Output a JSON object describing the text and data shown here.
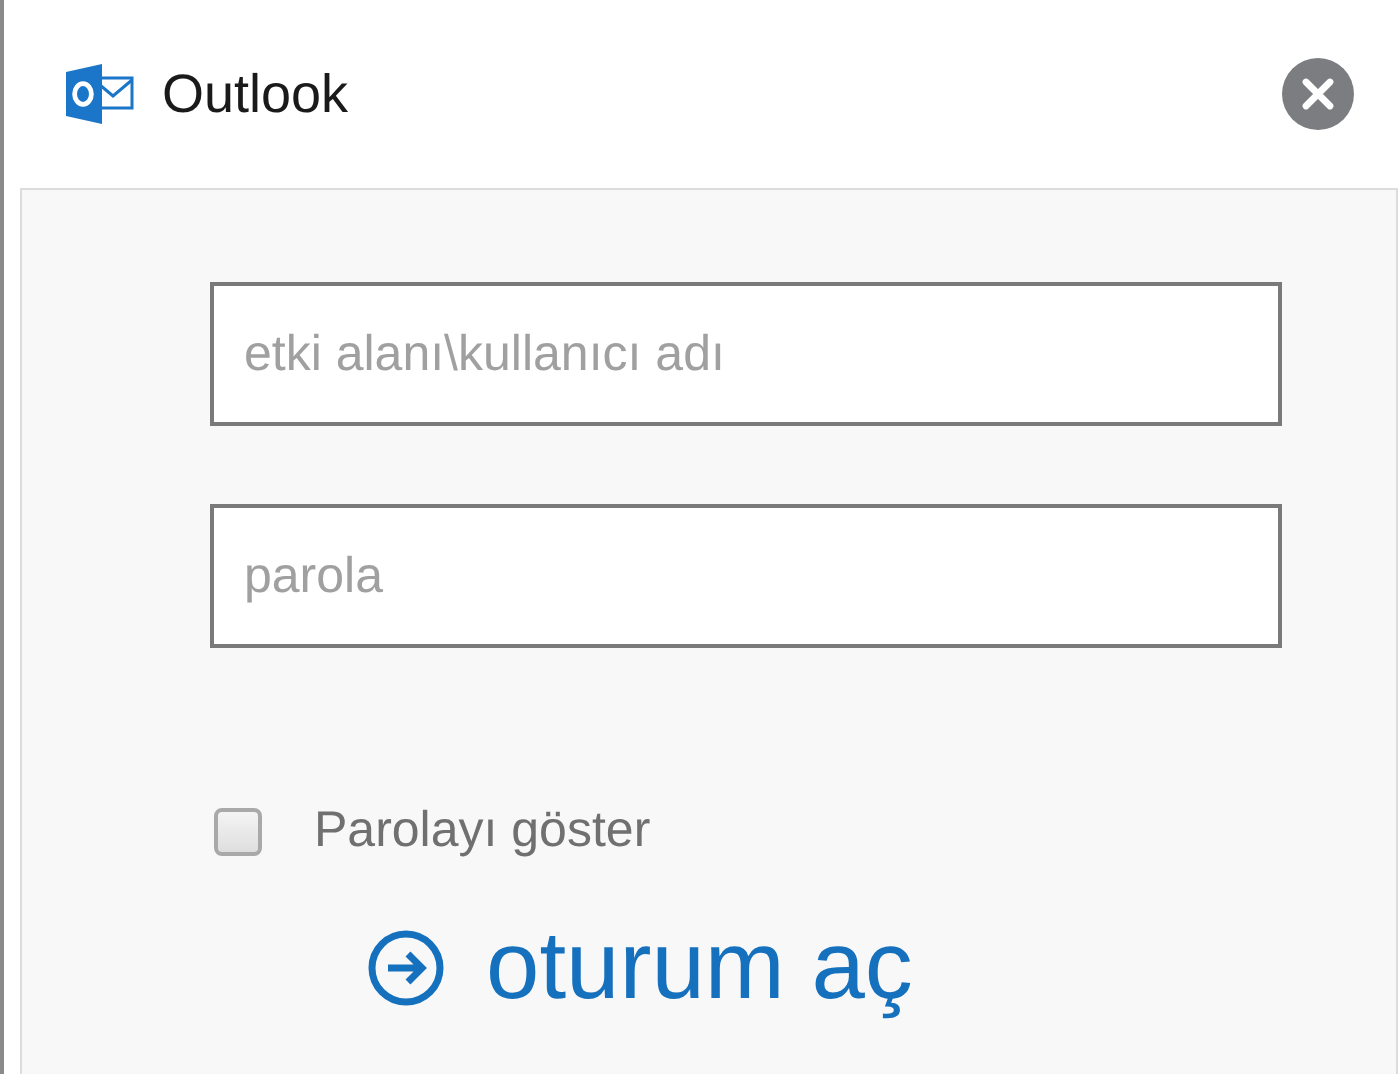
{
  "window": {
    "title": "Outlook"
  },
  "fields": [
    {
      "placeholder": "etki alanı\\kullanıcı adı"
    },
    {
      "placeholder": "parola"
    }
  ],
  "show_password": {
    "label": "Parolayı göster",
    "checked": false
  },
  "sign_in": {
    "label": "oturum aç"
  }
}
